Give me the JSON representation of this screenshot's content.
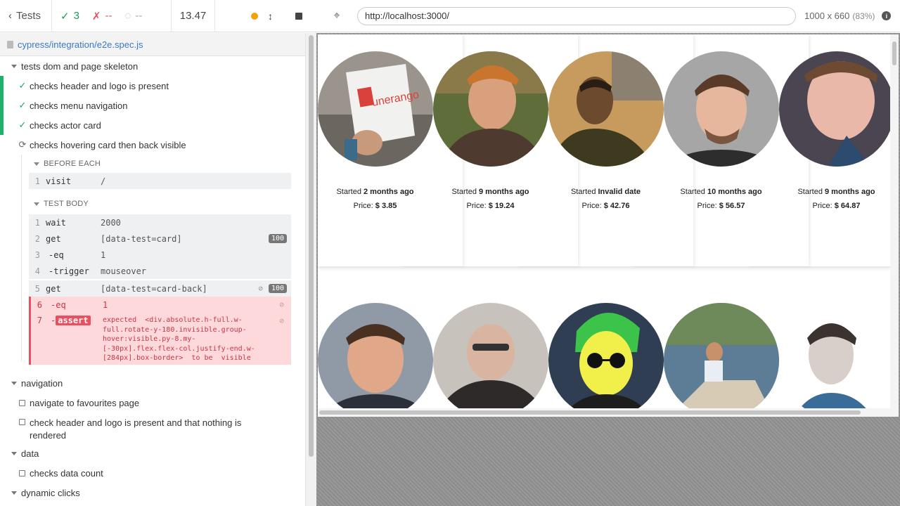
{
  "topbar": {
    "tests_label": "Tests",
    "passed": "3",
    "failed": "--",
    "pending": "--",
    "duration": "13.47"
  },
  "spec": {
    "file": "cypress/integration/e2e.spec.js"
  },
  "reporter": {
    "suite1": {
      "title": "tests dom and page skeleton",
      "tests": [
        {
          "title": "checks header and logo is present",
          "state": "passed"
        },
        {
          "title": "checks menu navigation",
          "state": "passed"
        },
        {
          "title": "checks actor card",
          "state": "passed"
        },
        {
          "title": "checks hovering card then back visible",
          "state": "running"
        }
      ],
      "before_each_label": "BEFORE EACH",
      "before_each": [
        {
          "num": "1",
          "name": "visit",
          "msg": "/"
        }
      ],
      "test_body_label": "TEST BODY",
      "body": [
        {
          "num": "1",
          "name": "wait",
          "msg": "2000"
        },
        {
          "num": "2",
          "name": "get",
          "msg": "[data-test=card]",
          "badge": "100"
        },
        {
          "num": "3",
          "name": "-eq",
          "msg": "1"
        },
        {
          "num": "4",
          "name": "-trigger",
          "msg": "mouseover"
        },
        {
          "num": "5",
          "name": "get",
          "msg": "[data-test=card-back]",
          "badge": "100"
        },
        {
          "num": "6",
          "name": "-eq",
          "msg": "1"
        },
        {
          "num": "7",
          "name": "-",
          "tag": "assert",
          "msg_line1": "expected  <div.absolute.h-full.w-",
          "msg_line2": "full.rotate-y-180.invisible.group-",
          "msg_line3": "hover:visible.py-8.my-",
          "msg_line4": "[-30px].flex.flex-col.justify-end.w-",
          "msg_line5": "[284px].box-border>  to be  visible"
        }
      ]
    },
    "suite2": {
      "title": "navigation",
      "tests": [
        {
          "title": "navigate to favourites page"
        },
        {
          "title": "check header and logo is present and that nothing is",
          "title2": "rendered"
        }
      ]
    },
    "suite3": {
      "title": "data",
      "tests": [
        {
          "title": "checks data count"
        }
      ]
    },
    "suite4": {
      "title": "dynamic clicks"
    }
  },
  "viewport": {
    "url": "http://localhost:3000/",
    "size": "1000 x 660",
    "scale": "(83%)",
    "info_icon": "i"
  },
  "cards": [
    {
      "started_prefix": "Started",
      "started": "2 months ago",
      "price_prefix": "Price:",
      "price": "$ 3.85"
    },
    {
      "started_prefix": "Started",
      "started": "9 months ago",
      "price_prefix": "Price:",
      "price": "$ 19.24"
    },
    {
      "started_prefix": "Started",
      "started": "Invalid date",
      "price_prefix": "Price:",
      "price": "$ 42.76"
    },
    {
      "started_prefix": "Started",
      "started": "10 months ago",
      "price_prefix": "Price:",
      "price": "$ 56.57"
    },
    {
      "started_prefix": "Started",
      "started": "9 months ago",
      "price_prefix": "Price:",
      "price": "$ 64.87"
    }
  ],
  "colors": {
    "pass": "#1fb06b",
    "fail": "#e94f5f",
    "running": "#f2a20b",
    "link": "#3b79c6"
  }
}
